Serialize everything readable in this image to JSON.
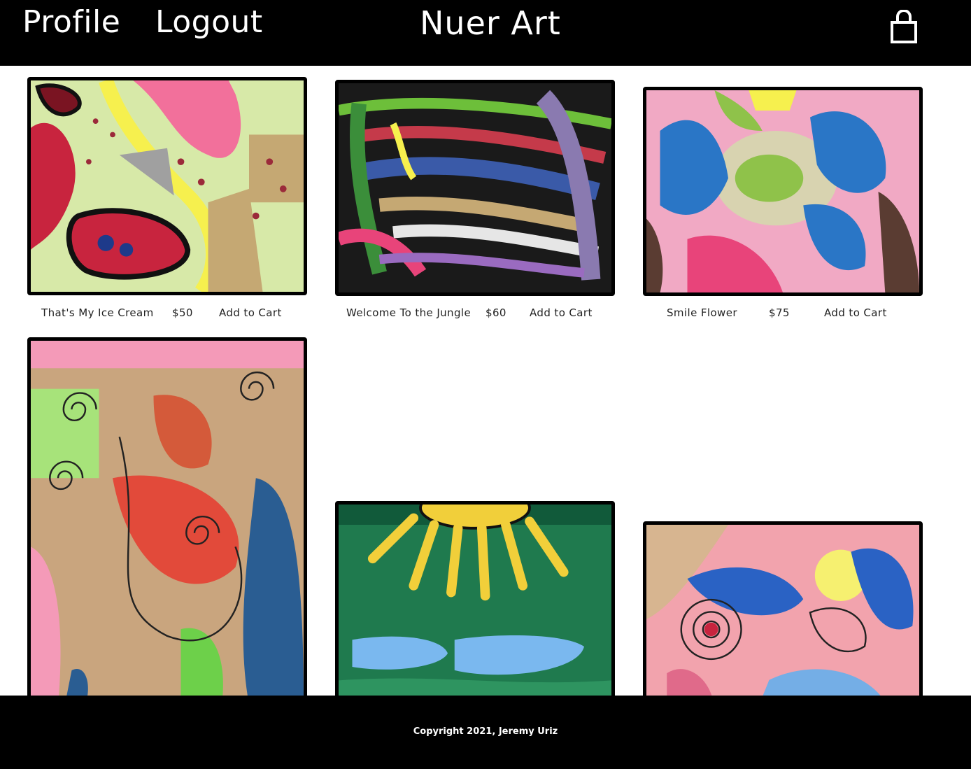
{
  "header": {
    "profile_label": "Profile",
    "logout_label": "Logout",
    "brand": "Nuer Art",
    "cart_icon": "shopping-bag-icon"
  },
  "artworks": [
    {
      "title": "That's My Ice Cream",
      "price": "$50",
      "action": "Add to Cart",
      "palette": [
        "#d7e9a8",
        "#f2507f",
        "#b8d34a",
        "#f6f04e",
        "#c5a873",
        "#7a1422"
      ]
    },
    {
      "title": "Welcome To the Jungle",
      "price": "$60",
      "action": "Add to Cart",
      "palette": [
        "#1a1a1a",
        "#6dbf3a",
        "#3a5aa8",
        "#c53a4a",
        "#e6e6e6",
        "#8a7ab0"
      ]
    },
    {
      "title": "Smile Flower",
      "price": "$75",
      "action": "Add to Cart",
      "palette": [
        "#f1a9c4",
        "#2a76c6",
        "#8fc24a",
        "#d8d3b0",
        "#5a3c32",
        "#e8447a"
      ]
    },
    {
      "title": "",
      "price": "",
      "action": "",
      "palette": [
        "#c9a57e",
        "#e24a3a",
        "#f49ab8",
        "#2a5d92",
        "#a7e37a",
        "#222222"
      ]
    },
    {
      "title": "",
      "price": "",
      "action": "",
      "palette": [
        "#1f7a4e",
        "#f1cf3a",
        "#7ab8ef",
        "#2e9460",
        "#115a3a",
        "#111111"
      ]
    },
    {
      "title": "",
      "price": "",
      "action": "",
      "palette": [
        "#f2a3ad",
        "#2a62c4",
        "#f6f070",
        "#e06a8a",
        "#74aee6",
        "#d7b590"
      ]
    }
  ],
  "footer": {
    "copyright": "Copyright 2021, Jeremy Uriz"
  }
}
